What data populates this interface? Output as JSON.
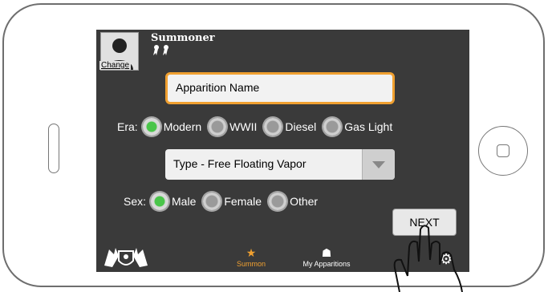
{
  "header": {
    "title": "Summoner",
    "change_link": "Change",
    "ribbons": "🎗🎗"
  },
  "name_field": {
    "value": "Apparition Name"
  },
  "era": {
    "label": "Era:",
    "options": [
      "Modern",
      "WWII",
      "Diesel",
      "Gas Light"
    ],
    "selected": "Modern"
  },
  "type_select": {
    "value": "Type - Free Floating Vapor"
  },
  "sex": {
    "label": "Sex:",
    "options": [
      "Male",
      "Female",
      "Other"
    ],
    "selected": "Male"
  },
  "next_button": "NEXT",
  "tabbar": {
    "summon": "Summon",
    "apparitions": "My Apparitions"
  },
  "colors": {
    "accent": "#f0a030",
    "radio_on": "#4ac54a",
    "screen_bg": "#3a3a3a"
  }
}
